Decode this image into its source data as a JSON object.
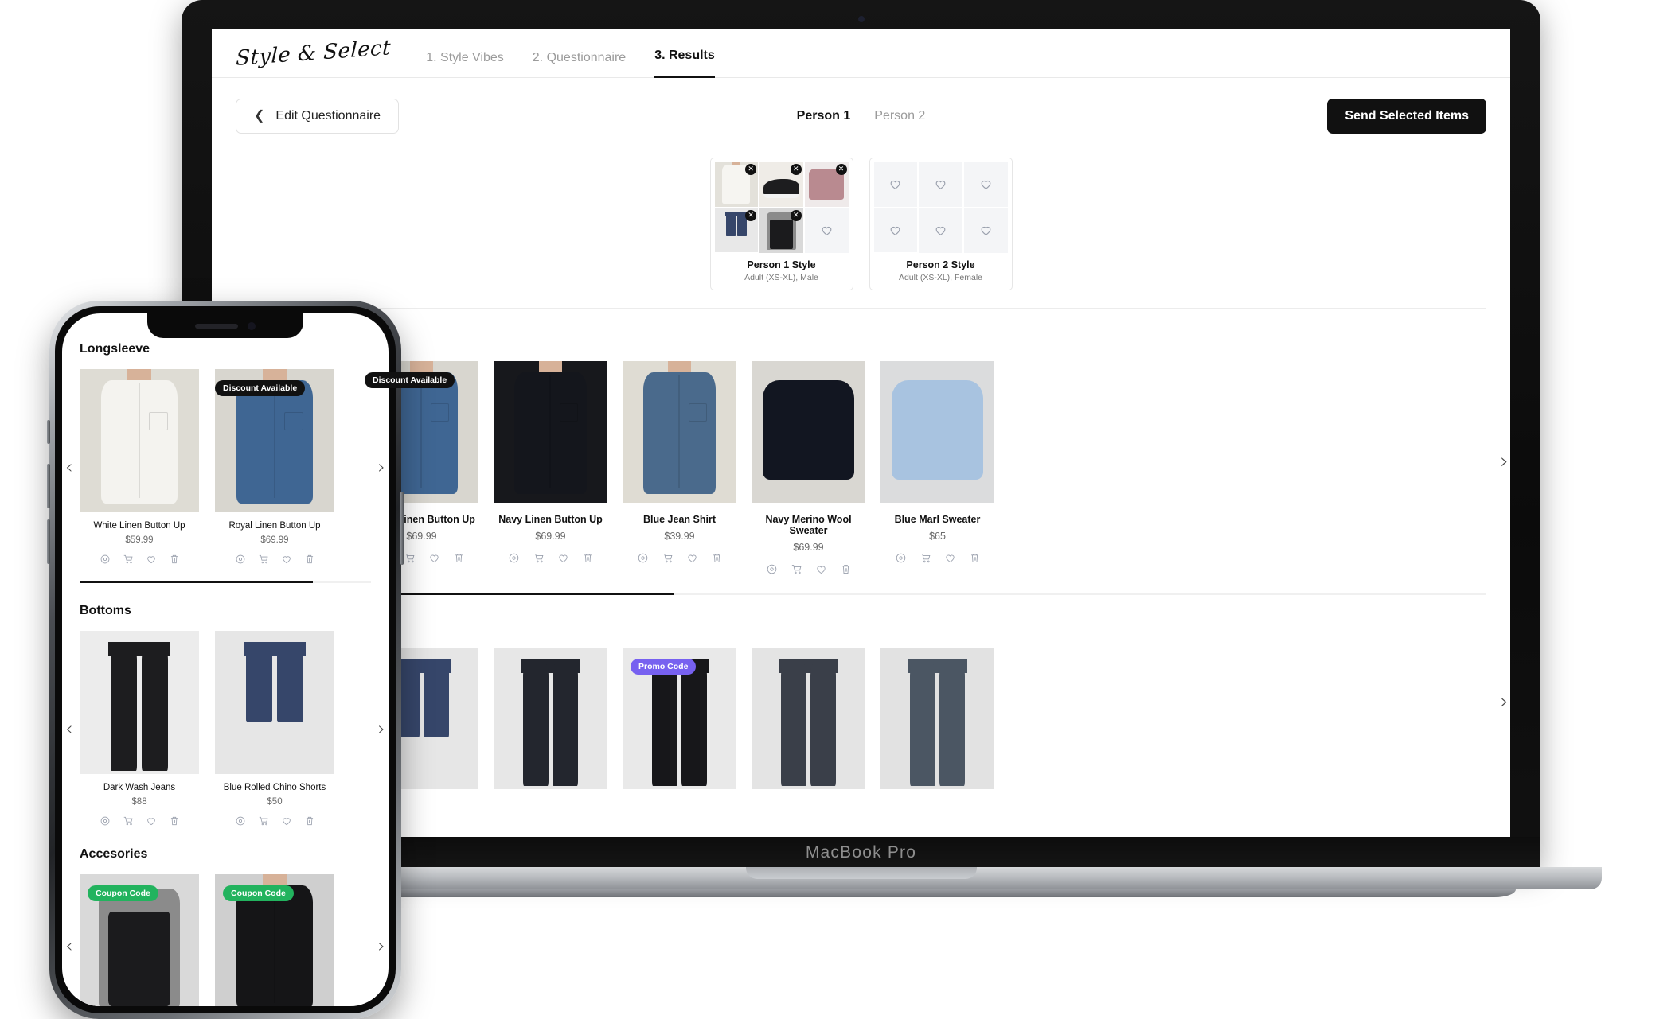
{
  "brand": {
    "name": "Style & Select"
  },
  "nav": {
    "items": [
      {
        "label": "1. Style Vibes",
        "active": false
      },
      {
        "label": "2. Questionnaire",
        "active": false
      },
      {
        "label": "3. Results",
        "active": true
      }
    ]
  },
  "actionbar": {
    "edit_label": "Edit Questionnaire",
    "send_label": "Send Selected Items",
    "person_tabs": [
      {
        "label": "Person 1",
        "active": true
      },
      {
        "label": "Person 2",
        "active": false
      }
    ]
  },
  "style_cards": [
    {
      "name": "Person 1 Style",
      "subtitle": "Adult (XS-XL), Male",
      "slots": [
        {
          "filled": true,
          "kind": "white-shirt",
          "remove_label": "✕"
        },
        {
          "filled": true,
          "kind": "black-sneaker",
          "remove_label": "✕"
        },
        {
          "filled": true,
          "kind": "pink-sweater",
          "remove_label": "✕"
        },
        {
          "filled": true,
          "kind": "navy-shorts",
          "remove_label": "✕"
        },
        {
          "filled": true,
          "kind": "grey-vest",
          "remove_label": "✕"
        },
        {
          "filled": false,
          "kind": "empty"
        }
      ]
    },
    {
      "name": "Person 2 Style",
      "subtitle": "Adult (XS-XL), Female",
      "slots": [
        {
          "filled": false,
          "kind": "empty"
        },
        {
          "filled": false,
          "kind": "empty"
        },
        {
          "filled": false,
          "kind": "empty"
        },
        {
          "filled": false,
          "kind": "empty"
        },
        {
          "filled": false,
          "kind": "empty"
        },
        {
          "filled": false,
          "kind": "empty"
        }
      ]
    }
  ],
  "colors": {
    "accent_dark": "#111111",
    "badge_dark": "#111111",
    "badge_purple": "#7761f0",
    "badge_green": "#22b35e",
    "muted_text": "#9b9b9b"
  },
  "icons": {
    "view": "eye-icon",
    "cart": "cart-icon",
    "like": "heart-icon",
    "remove": "trash-icon",
    "prev": "chevron-left-icon",
    "next": "chevron-right-icon"
  },
  "desktop_sections": [
    {
      "title": "Longsleeve",
      "progress_percent": 35,
      "prev_label": "‹",
      "next_label": "›",
      "products": [
        {
          "name": "White Linen Button Up",
          "price": "$59.99",
          "badge": null,
          "badge_type": null,
          "art": "shirt-white"
        },
        {
          "name": "Royal Linen Button Up",
          "price": "$69.99",
          "badge": "Discount Available",
          "badge_type": "dark",
          "art": "shirt-royal"
        },
        {
          "name": "Navy Linen Button Up",
          "price": "$69.99",
          "badge": null,
          "badge_type": null,
          "art": "shirt-navy"
        },
        {
          "name": "Blue Jean Shirt",
          "price": "$39.99",
          "badge": null,
          "badge_type": null,
          "art": "shirt-denim"
        },
        {
          "name": "Navy Merino Wool Sweater",
          "price": "$69.99",
          "badge": null,
          "badge_type": null,
          "art": "sweater-navy"
        },
        {
          "name": "Blue Marl Sweater",
          "price": "$65",
          "badge": null,
          "badge_type": null,
          "art": "sweater-bluemarl"
        }
      ]
    },
    {
      "title": "Bottoms",
      "progress_percent": 35,
      "prev_label": "‹",
      "next_label": "›",
      "products": [
        {
          "name": "",
          "price": "",
          "badge": null,
          "badge_type": null,
          "art": "pants-black"
        },
        {
          "name": "",
          "price": "",
          "badge": null,
          "badge_type": null,
          "art": "shorts-navy"
        },
        {
          "name": "",
          "price": "",
          "badge": null,
          "badge_type": null,
          "art": "jeans-dark"
        },
        {
          "name": "",
          "price": "",
          "badge": "Promo Code",
          "badge_type": "purple",
          "art": "jeans-black"
        },
        {
          "name": "",
          "price": "",
          "badge": null,
          "badge_type": null,
          "art": "jeans-washed"
        },
        {
          "name": "",
          "price": "",
          "badge": null,
          "badge_type": null,
          "art": "jeans-blue"
        }
      ]
    }
  ],
  "mobile_sections": [
    {
      "title": "Longsleeve",
      "progress_percent": 80,
      "prev_label": "‹",
      "next_label": "›",
      "products": [
        {
          "name": "White Linen Button Up",
          "price": "$59.99",
          "badge": null,
          "badge_type": null,
          "art": "shirt-white"
        },
        {
          "name": "Royal Linen Button Up",
          "price": "$69.99",
          "badge": "Discount Available",
          "badge_type": "dark",
          "art": "shirt-royal"
        }
      ]
    },
    {
      "title": "Bottoms",
      "progress_percent": 0,
      "prev_label": "‹",
      "next_label": "›",
      "products": [
        {
          "name": "Dark Wash Jeans",
          "price": "$88",
          "badge": null,
          "badge_type": null,
          "art": "pants-black"
        },
        {
          "name": "Blue Rolled Chino Shorts",
          "price": "$50",
          "badge": null,
          "badge_type": null,
          "art": "shorts-navy"
        }
      ]
    },
    {
      "title": "Accesories",
      "progress_percent": 0,
      "prev_label": "‹",
      "next_label": "›",
      "products": [
        {
          "name": "",
          "price": "",
          "badge": "Coupon Code",
          "badge_type": "green",
          "art": "grey-vest"
        },
        {
          "name": "",
          "price": "",
          "badge": "Coupon Code",
          "badge_type": "green",
          "art": "black-jacket"
        }
      ]
    }
  ],
  "device": {
    "laptop_label": "MacBook Pro"
  }
}
